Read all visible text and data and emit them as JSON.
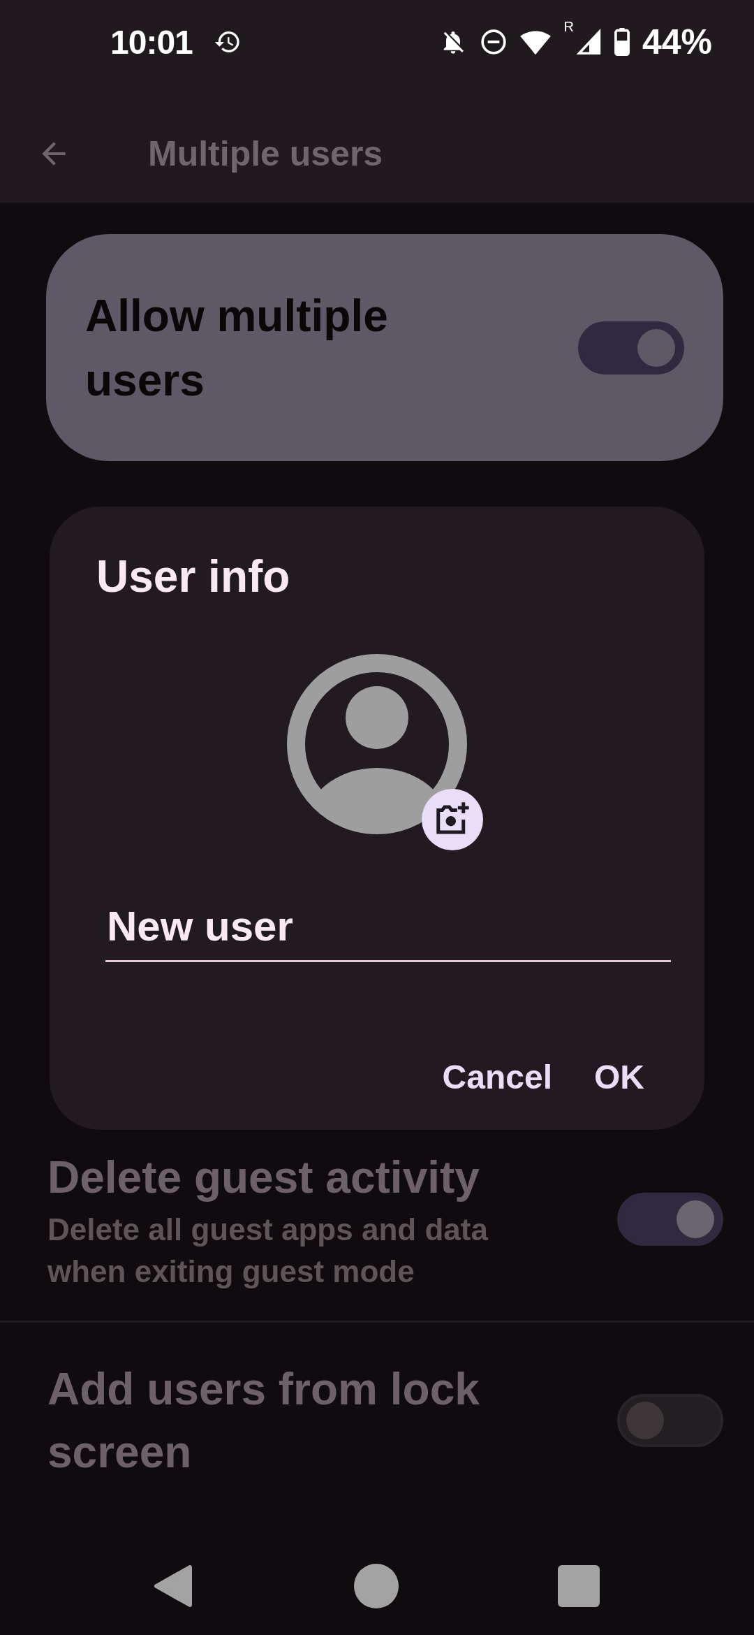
{
  "status_bar": {
    "time": "10:01",
    "roaming": "R",
    "battery": "44%"
  },
  "app_bar": {
    "title": "Multiple users"
  },
  "main_toggle": {
    "label": "Allow multiple users",
    "on": true
  },
  "settings": [
    {
      "title": "Delete guest activity",
      "subtitle": "Delete all guest apps and data when exiting guest mode",
      "on": true
    },
    {
      "title": "Add users from lock screen",
      "on": false
    }
  ],
  "dialog": {
    "title": "User info",
    "name_field": {
      "value": "New user"
    },
    "buttons": [
      "Cancel",
      "OK"
    ]
  }
}
